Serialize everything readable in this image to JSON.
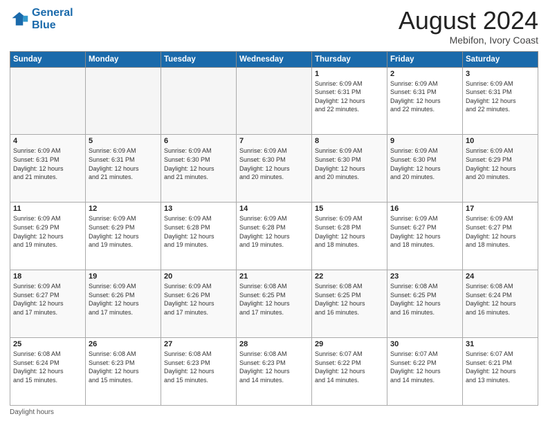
{
  "header": {
    "logo_line1": "General",
    "logo_line2": "Blue",
    "month_title": "August 2024",
    "location": "Mebifon, Ivory Coast"
  },
  "weekdays": [
    "Sunday",
    "Monday",
    "Tuesday",
    "Wednesday",
    "Thursday",
    "Friday",
    "Saturday"
  ],
  "weeks": [
    [
      {
        "day": "",
        "info": ""
      },
      {
        "day": "",
        "info": ""
      },
      {
        "day": "",
        "info": ""
      },
      {
        "day": "",
        "info": ""
      },
      {
        "day": "1",
        "info": "Sunrise: 6:09 AM\nSunset: 6:31 PM\nDaylight: 12 hours\nand 22 minutes."
      },
      {
        "day": "2",
        "info": "Sunrise: 6:09 AM\nSunset: 6:31 PM\nDaylight: 12 hours\nand 22 minutes."
      },
      {
        "day": "3",
        "info": "Sunrise: 6:09 AM\nSunset: 6:31 PM\nDaylight: 12 hours\nand 22 minutes."
      }
    ],
    [
      {
        "day": "4",
        "info": "Sunrise: 6:09 AM\nSunset: 6:31 PM\nDaylight: 12 hours\nand 21 minutes."
      },
      {
        "day": "5",
        "info": "Sunrise: 6:09 AM\nSunset: 6:31 PM\nDaylight: 12 hours\nand 21 minutes."
      },
      {
        "day": "6",
        "info": "Sunrise: 6:09 AM\nSunset: 6:30 PM\nDaylight: 12 hours\nand 21 minutes."
      },
      {
        "day": "7",
        "info": "Sunrise: 6:09 AM\nSunset: 6:30 PM\nDaylight: 12 hours\nand 20 minutes."
      },
      {
        "day": "8",
        "info": "Sunrise: 6:09 AM\nSunset: 6:30 PM\nDaylight: 12 hours\nand 20 minutes."
      },
      {
        "day": "9",
        "info": "Sunrise: 6:09 AM\nSunset: 6:30 PM\nDaylight: 12 hours\nand 20 minutes."
      },
      {
        "day": "10",
        "info": "Sunrise: 6:09 AM\nSunset: 6:29 PM\nDaylight: 12 hours\nand 20 minutes."
      }
    ],
    [
      {
        "day": "11",
        "info": "Sunrise: 6:09 AM\nSunset: 6:29 PM\nDaylight: 12 hours\nand 19 minutes."
      },
      {
        "day": "12",
        "info": "Sunrise: 6:09 AM\nSunset: 6:29 PM\nDaylight: 12 hours\nand 19 minutes."
      },
      {
        "day": "13",
        "info": "Sunrise: 6:09 AM\nSunset: 6:28 PM\nDaylight: 12 hours\nand 19 minutes."
      },
      {
        "day": "14",
        "info": "Sunrise: 6:09 AM\nSunset: 6:28 PM\nDaylight: 12 hours\nand 19 minutes."
      },
      {
        "day": "15",
        "info": "Sunrise: 6:09 AM\nSunset: 6:28 PM\nDaylight: 12 hours\nand 18 minutes."
      },
      {
        "day": "16",
        "info": "Sunrise: 6:09 AM\nSunset: 6:27 PM\nDaylight: 12 hours\nand 18 minutes."
      },
      {
        "day": "17",
        "info": "Sunrise: 6:09 AM\nSunset: 6:27 PM\nDaylight: 12 hours\nand 18 minutes."
      }
    ],
    [
      {
        "day": "18",
        "info": "Sunrise: 6:09 AM\nSunset: 6:27 PM\nDaylight: 12 hours\nand 17 minutes."
      },
      {
        "day": "19",
        "info": "Sunrise: 6:09 AM\nSunset: 6:26 PM\nDaylight: 12 hours\nand 17 minutes."
      },
      {
        "day": "20",
        "info": "Sunrise: 6:09 AM\nSunset: 6:26 PM\nDaylight: 12 hours\nand 17 minutes."
      },
      {
        "day": "21",
        "info": "Sunrise: 6:08 AM\nSunset: 6:25 PM\nDaylight: 12 hours\nand 17 minutes."
      },
      {
        "day": "22",
        "info": "Sunrise: 6:08 AM\nSunset: 6:25 PM\nDaylight: 12 hours\nand 16 minutes."
      },
      {
        "day": "23",
        "info": "Sunrise: 6:08 AM\nSunset: 6:25 PM\nDaylight: 12 hours\nand 16 minutes."
      },
      {
        "day": "24",
        "info": "Sunrise: 6:08 AM\nSunset: 6:24 PM\nDaylight: 12 hours\nand 16 minutes."
      }
    ],
    [
      {
        "day": "25",
        "info": "Sunrise: 6:08 AM\nSunset: 6:24 PM\nDaylight: 12 hours\nand 15 minutes."
      },
      {
        "day": "26",
        "info": "Sunrise: 6:08 AM\nSunset: 6:23 PM\nDaylight: 12 hours\nand 15 minutes."
      },
      {
        "day": "27",
        "info": "Sunrise: 6:08 AM\nSunset: 6:23 PM\nDaylight: 12 hours\nand 15 minutes."
      },
      {
        "day": "28",
        "info": "Sunrise: 6:08 AM\nSunset: 6:23 PM\nDaylight: 12 hours\nand 14 minutes."
      },
      {
        "day": "29",
        "info": "Sunrise: 6:07 AM\nSunset: 6:22 PM\nDaylight: 12 hours\nand 14 minutes."
      },
      {
        "day": "30",
        "info": "Sunrise: 6:07 AM\nSunset: 6:22 PM\nDaylight: 12 hours\nand 14 minutes."
      },
      {
        "day": "31",
        "info": "Sunrise: 6:07 AM\nSunset: 6:21 PM\nDaylight: 12 hours\nand 13 minutes."
      }
    ]
  ],
  "footer": {
    "daylight_label": "Daylight hours"
  }
}
